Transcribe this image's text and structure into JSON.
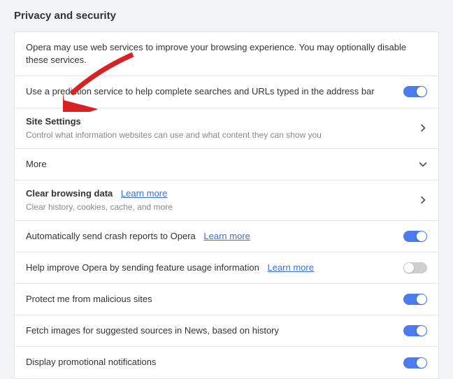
{
  "section_title": "Privacy and security",
  "info_row": "Opera may use web services to improve your browsing experience. You may optionally disable these services.",
  "rows": {
    "prediction": {
      "label": "Use a prediction service to help complete searches and URLs typed in the address bar",
      "toggle": true
    },
    "site_settings": {
      "title": "Site Settings",
      "sub": "Control what information websites can use and what content they can show you"
    },
    "more": {
      "title": "More"
    },
    "clear_data": {
      "title": "Clear browsing data",
      "learn": "Learn more",
      "sub": "Clear history, cookies, cache, and more"
    },
    "crash": {
      "label": "Automatically send crash reports to Opera",
      "learn": "Learn more",
      "toggle": true
    },
    "usage": {
      "label": "Help improve Opera by sending feature usage information",
      "learn": "Learn more",
      "toggle": false
    },
    "malicious": {
      "label": "Protect me from malicious sites",
      "toggle": true
    },
    "news_images": {
      "label": "Fetch images for suggested sources in News, based on history",
      "toggle": true
    },
    "promo": {
      "label": "Display promotional notifications",
      "toggle": true
    }
  }
}
